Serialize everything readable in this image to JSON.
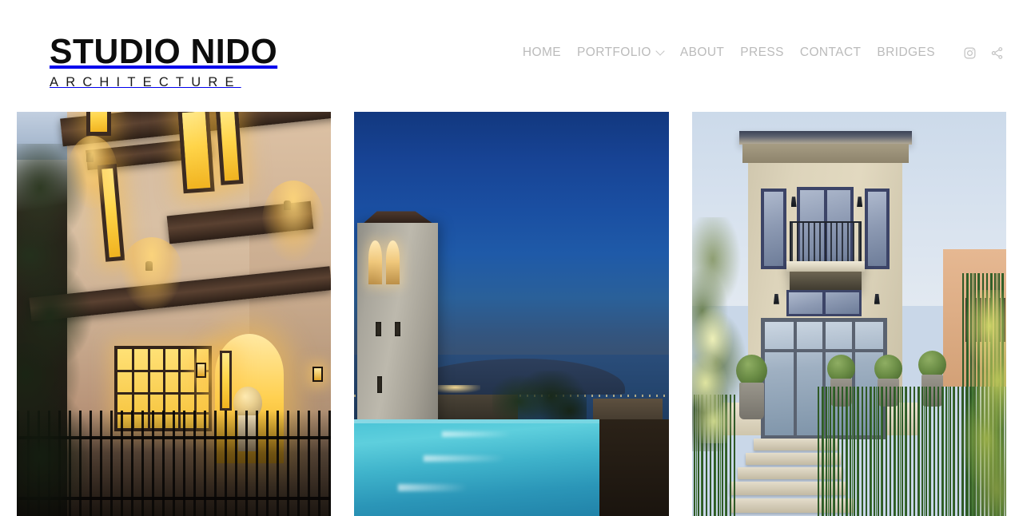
{
  "site": {
    "brand_name": "STUDIO NIDO",
    "brand_subtitle": "ARCHITECTURE",
    "background_color": "#ffffff"
  },
  "header": {
    "nav_items": [
      {
        "label": "HOME",
        "has_dropdown": false
      },
      {
        "label": "PORTFOLIO",
        "has_dropdown": true
      },
      {
        "label": "ABOUT",
        "has_dropdown": false
      },
      {
        "label": "PRESS",
        "has_dropdown": false
      },
      {
        "label": "CONTACT",
        "has_dropdown": false
      },
      {
        "label": "BRIDGES",
        "has_dropdown": false
      }
    ],
    "nav_text_color": "#bbbbbb",
    "social": [
      {
        "name": "instagram-icon",
        "label": "Instagram"
      },
      {
        "name": "share-icon",
        "label": "Share"
      }
    ]
  },
  "gallery": {
    "tiles": [
      {
        "name": "craftsman-residence",
        "alt": "Craftsman style residence facade illuminated at dusk with warm amber windows, bay windows, deep eaves, magnolia tree and wrought iron entry gate",
        "dominant_color": "#d6bda2",
        "accent_color": "#ffd54a"
      },
      {
        "name": "tower-infinity-pool",
        "alt": "Concrete tower with arched belfry beside a turquoise infinity pool at blue hour overlooking the bay and distant island lights",
        "dominant_color": "#1a4f9e",
        "accent_color": "#49c3d6"
      },
      {
        "name": "stucco-villa-garden",
        "alt": "Contemporary stucco villa with blue framed windows, iron balcony and a horsetail reed garden with stone steps and topiary in planters",
        "dominant_color": "#ddd4bb",
        "accent_color": "#3d7333"
      }
    ]
  }
}
